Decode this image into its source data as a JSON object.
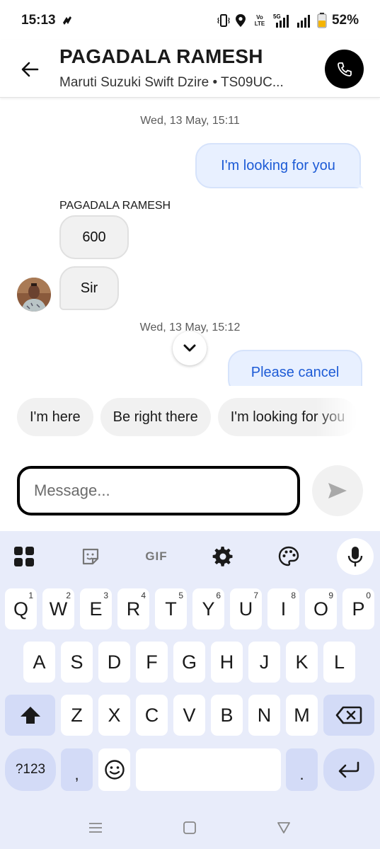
{
  "status_bar": {
    "time": "15:13",
    "battery_percent": "52%",
    "network_5g": "5G",
    "volte": "Vo LTE",
    "icons": [
      "vibrate-icon",
      "location-icon",
      "signal-icon",
      "battery-icon"
    ]
  },
  "header": {
    "name": "PAGADALA RAMESH",
    "subtitle": "Maruti Suzuki Swift Dzire • TS09UC..."
  },
  "chat": {
    "timestamp_1": "Wed, 13 May, 15:11",
    "out_msg_1": "I'm looking for you",
    "sender": "PAGADALA RAMESH",
    "in_msg_1": "600",
    "in_msg_2": "Sir",
    "timestamp_2": "Wed, 13 May, 15:12",
    "out_msg_2": "Please cancel"
  },
  "quick_replies": [
    "I'm here",
    "Be right there",
    "I'm looking for you"
  ],
  "composer": {
    "placeholder": "Message...",
    "value": ""
  },
  "keyboard": {
    "toolbar": [
      "apps-icon",
      "sticker-icon",
      "GIF",
      "settings-icon",
      "palette-icon",
      "mic-icon"
    ],
    "gif_label": "GIF",
    "row1": [
      "Q",
      "W",
      "E",
      "R",
      "T",
      "Y",
      "U",
      "I",
      "O",
      "P"
    ],
    "row1_hints": [
      "1",
      "2",
      "3",
      "4",
      "5",
      "6",
      "7",
      "8",
      "9",
      "0"
    ],
    "row2": [
      "A",
      "S",
      "D",
      "F",
      "G",
      "H",
      "J",
      "K",
      "L"
    ],
    "row3": [
      "Z",
      "X",
      "C",
      "V",
      "B",
      "N",
      "M"
    ],
    "symbols_label": "?123",
    "comma": ",",
    "period": "."
  },
  "colors": {
    "accent_blue": "#1d5bd6",
    "outgoing_bubble": "#e8f0ff",
    "keyboard_bg": "#e8ecfa"
  }
}
